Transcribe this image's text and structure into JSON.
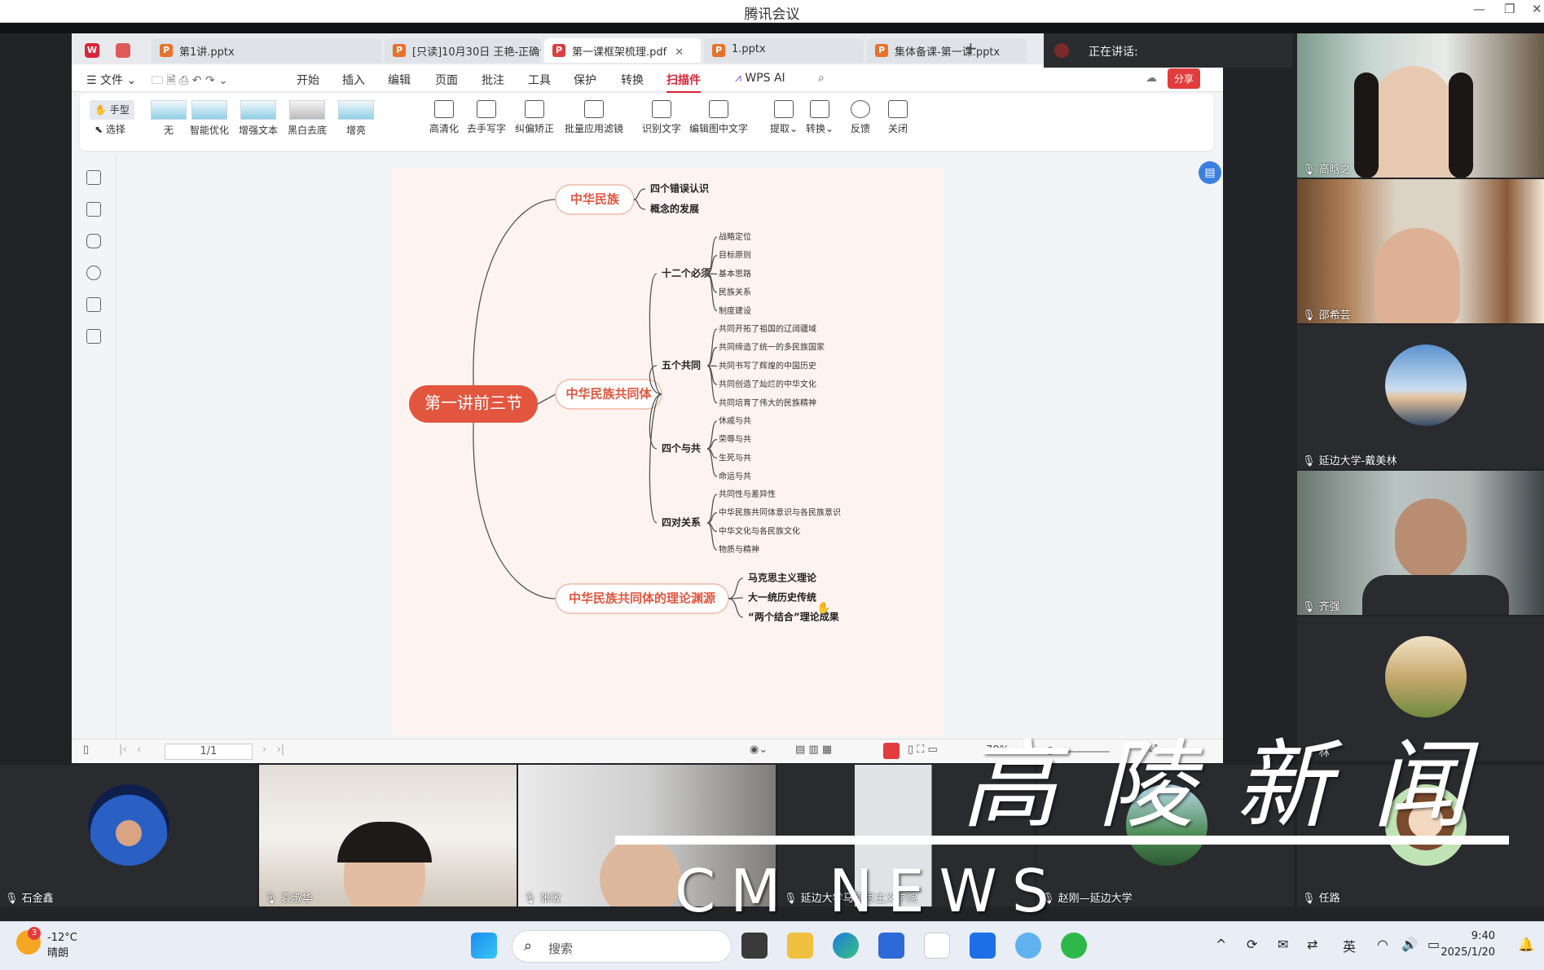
{
  "window": {
    "title": "腾讯会议"
  },
  "speaking": {
    "label": "正在讲话:"
  },
  "tabs": [
    {
      "label": "第1讲.pptx",
      "icon": "P"
    },
    {
      "label": "[只读]10月30日 王艳-正确认",
      "icon": "P"
    },
    {
      "label": "第一课框架梳理.pdf",
      "icon": "pdf-icon"
    },
    {
      "label": "1.pptx",
      "icon": "P"
    },
    {
      "label": "集体备课-第一课.pptx",
      "icon": "P"
    }
  ],
  "menu": [
    "文件",
    "开始",
    "插入",
    "编辑",
    "页面",
    "批注",
    "工具",
    "保护",
    "转换",
    "扫描件",
    "WPS AI"
  ],
  "menu_active": "扫描件",
  "share_label": "分享",
  "ribbon": {
    "mode": [
      "手型",
      "选择"
    ],
    "filters": [
      "无",
      "智能优化",
      "增强文本",
      "黑白去底",
      "增亮"
    ],
    "tools": [
      "高清化",
      "去手写字",
      "纠偏矫正",
      "批量应用滤镜",
      "识别文字",
      "编辑图中文字",
      "提取",
      "转换",
      "反馈",
      "关闭"
    ]
  },
  "mindmap": {
    "root": "第一讲前三节",
    "branches": [
      {
        "label": "中华民族",
        "children": [
          {
            "label": "四个错误认识"
          },
          {
            "label": "概念的发展"
          }
        ]
      },
      {
        "label": "中华民族共同体",
        "children": [
          {
            "label": "十二个必须",
            "children": [
              "战略定位",
              "目标原则",
              "基本思路",
              "民族关系",
              "制度建设"
            ]
          },
          {
            "label": "五个共同",
            "children": [
              "共同开拓了祖国的辽阔疆域",
              "共同缔造了统一的多民族国家",
              "共同书写了辉煌的中国历史",
              "共同创造了灿烂的中华文化",
              "共同培育了伟大的民族精神"
            ]
          },
          {
            "label": "四个与共",
            "children": [
              "休戚与共",
              "荣辱与共",
              "生死与共",
              "命运与共"
            ]
          },
          {
            "label": "四对关系",
            "children": [
              "共同性与差异性",
              "中华民族共同体意识与各民族意识",
              "中华文化与各民族文化",
              "物质与精神"
            ]
          }
        ]
      },
      {
        "label": "中华民族共同体的理论渊源",
        "children": [
          {
            "label": "马克思主义理论"
          },
          {
            "label": "大一统历史传统"
          },
          {
            "label": "“两个结合”理论成果"
          }
        ]
      }
    ]
  },
  "statusbar": {
    "page": "1/1",
    "zoom": "78%"
  },
  "participants_right": [
    {
      "name": "高晗之"
    },
    {
      "name": "邵希芸"
    },
    {
      "name": "延边大学-戴美林"
    },
    {
      "name": "齐强"
    },
    {
      "name": "林"
    }
  ],
  "participants_bottom": [
    {
      "name": "石金鑫"
    },
    {
      "name": "袁淑华"
    },
    {
      "name": "张敏"
    },
    {
      "name": "延边大学马克思主义学院"
    },
    {
      "name": "赵刚—延边大学"
    },
    {
      "name": "任路"
    }
  ],
  "watermark": {
    "cn": "高陵新闻",
    "en": "CM NEWS"
  },
  "taskbar": {
    "weather_badge": "3",
    "temp": "-12°C",
    "weather": "晴朗",
    "search_placeholder": "搜索",
    "ime": "英",
    "time": "9:40",
    "date": "2025/1/20"
  },
  "colors": {
    "accent_red": "#e2563f",
    "node_border": "#f0b9a7",
    "doc_bg": "#fdf4f1"
  }
}
